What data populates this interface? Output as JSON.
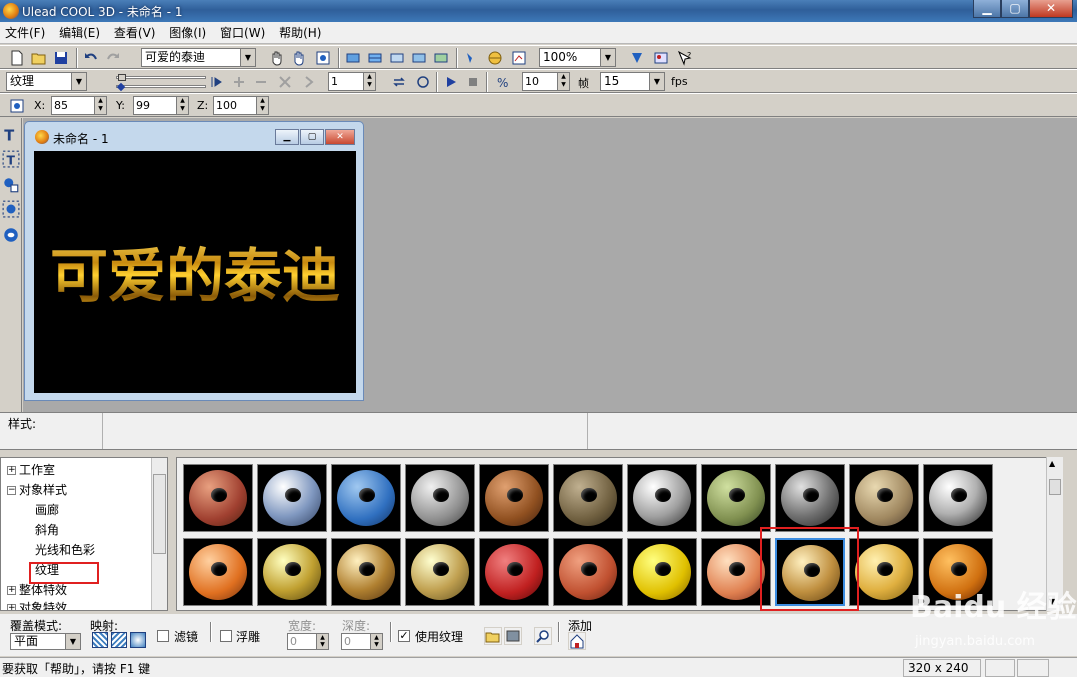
{
  "window": {
    "title": "Ulead COOL 3D - 未命名 - 1"
  },
  "menu": [
    "文件(F)",
    "编辑(E)",
    "查看(V)",
    "图像(I)",
    "窗口(W)",
    "帮助(H)"
  ],
  "toolbar1": {
    "object_select": "可爱的泰迪",
    "zoom": "100%"
  },
  "toolbar2": {
    "attribute_select": "纹理",
    "frame_value": "1",
    "speed_value": "10",
    "frames_label": "帧",
    "frames_value": "15",
    "fps_label": "fps"
  },
  "toolbar3": {
    "x_label": "X:",
    "x_value": "85",
    "y_label": "Y:",
    "y_value": "99",
    "z_label": "Z:",
    "z_value": "100"
  },
  "document": {
    "title": "未命名 - 1",
    "canvas_text": "可爱的泰迪"
  },
  "stylebar": {
    "label": "样式:"
  },
  "tree": {
    "items": [
      "工作室",
      "对象样式",
      "画廊",
      "斜角",
      "光线和色彩",
      "纹理",
      "整体特效",
      "对象特效"
    ]
  },
  "thumbnails": {
    "row1": [
      "brick",
      "blue-pattern",
      "blue-speckle",
      "grey-brick",
      "wood-plank",
      "stone",
      "marble",
      "green-moss",
      "granite",
      "sand",
      "chrome"
    ],
    "row2": [
      "orange",
      "gold",
      "bronze",
      "brass",
      "red-brick",
      "orange-brick",
      "yellow",
      "peach",
      "wood-grain",
      "golden-wood",
      "rust"
    ],
    "selected_index_row2": 8
  },
  "bottom": {
    "overlay_label": "覆盖模式:",
    "overlay_value": "平面",
    "mapping_label": "映射:",
    "filter_label": "滤镜",
    "emboss_label": "浮雕",
    "width_label": "宽度:",
    "width_value": "0",
    "depth_label": "深度:",
    "depth_value": "0",
    "use_texture_label": "使用纹理",
    "use_texture_checked": "✓",
    "add_label": "添加"
  },
  "status": {
    "message": "要获取「帮助」，请按 F1 键",
    "dimensions": "320 x 240"
  },
  "watermark": {
    "brand": "Baidu 经验",
    "url": "jingyan.baidu.com"
  },
  "colors": {
    "title_bar": "#2f5f9a",
    "highlight_red": "#e02020",
    "selection_blue": "#3c8ce0",
    "text_gold": "#f0c020"
  }
}
